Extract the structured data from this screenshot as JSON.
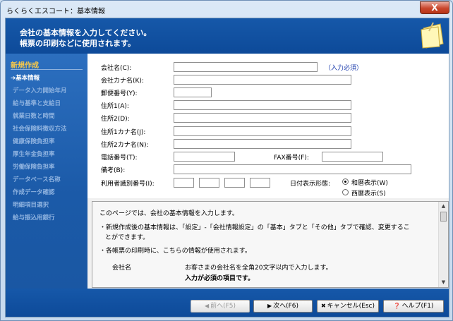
{
  "window": {
    "title": "らくらくエスコート：基本情報",
    "close_label": "X"
  },
  "banner": {
    "line1": "会社の基本情報を入力してください。",
    "line2": "帳票の印刷などに使用されます。",
    "icon": "sticky-notes-icon"
  },
  "sidebar": {
    "title": "新規作成",
    "items": [
      {
        "label": "➔基本情報",
        "active": true
      },
      {
        "label": "データ入力開始年月"
      },
      {
        "label": "給与基準と支給日"
      },
      {
        "label": "就業日数と時間"
      },
      {
        "label": "社会保険料徴収方法"
      },
      {
        "label": "健康保険負担率"
      },
      {
        "label": "厚生年金負担率"
      },
      {
        "label": "労働保険負担率"
      },
      {
        "label": "データベース名称"
      },
      {
        "label": "作成データ確認"
      },
      {
        "label": "明細項目選択"
      },
      {
        "label": "給与振込用銀行"
      }
    ]
  },
  "form": {
    "company_name": "会社名(C):",
    "required_note": "（入力必須）",
    "company_kana": "会社カナ名(K):",
    "postal": "郵便番号(Y):",
    "addr1": "住所1(A):",
    "addr2": "住所2(D):",
    "addr1_kana": "住所1カナ名(J):",
    "addr2_kana": "住所2カナ名(N):",
    "phone": "電話番号(T):",
    "fax": "FAX番号(F):",
    "note": "備考(B):",
    "user_id": "利用者識別番号(I):",
    "date_format": "日付表示形態:",
    "radio_wareki": "和暦表示(W)",
    "radio_seireki": "西暦表示(S)"
  },
  "help": {
    "line1": "このページでは、会社の基本情報を入力します。",
    "line2": "・新規作成後の基本情報は、「設定」-「会社情報設定」の「基本」タブと「その他」タブで確認、変更するこ",
    "line3": "とができます。",
    "line4": "・各帳票の印刷時に、こちらの情報が使用されます。",
    "field_name": "会社名",
    "field_desc1": "お客さまの会社名を全角20文字以内で入力します。",
    "field_desc2": "入力が必須の項目です。"
  },
  "footer": {
    "prev_label": "前へ(F5)",
    "next_label": "次へ(F6)",
    "cancel_label": "キャンセル(Esc)",
    "help_label": "ヘルプ(F1)"
  },
  "colors": {
    "banner": "#1658a9",
    "sidebar": "#2c6fbf",
    "accent_title": "#f7c84a"
  }
}
